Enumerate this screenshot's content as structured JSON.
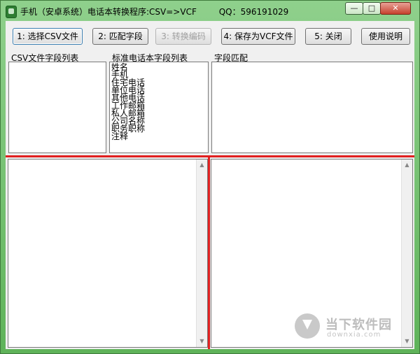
{
  "window": {
    "title": "手机（安卓系统）电话本转换程序:CSV=>VCF",
    "qq": "QQ：596191029",
    "controls": {
      "minimize": "—",
      "maximize": "□",
      "close": "✕"
    }
  },
  "toolbar": {
    "select_csv": "1: 选择CSV文件",
    "match_fields": "2: 匹配字段",
    "convert_encoding": "3: 转换编码",
    "save_vcf": "4: 保存为VCF文件",
    "close": "5: 关闭",
    "help": "使用说明"
  },
  "panels": {
    "csv_fields_label": "CSV文件字段列表",
    "standard_fields_label": "标准电话本字段列表",
    "field_match_label": "字段匹配",
    "standard_fields": [
      "姓名",
      "手机",
      "住宅电话",
      "单位电话",
      "其他电话",
      "工作邮箱",
      "私人邮箱",
      "公司名称",
      "职务职称",
      "注释"
    ]
  },
  "watermark": {
    "title": "当下软件园",
    "subtitle": "downxia.com"
  }
}
